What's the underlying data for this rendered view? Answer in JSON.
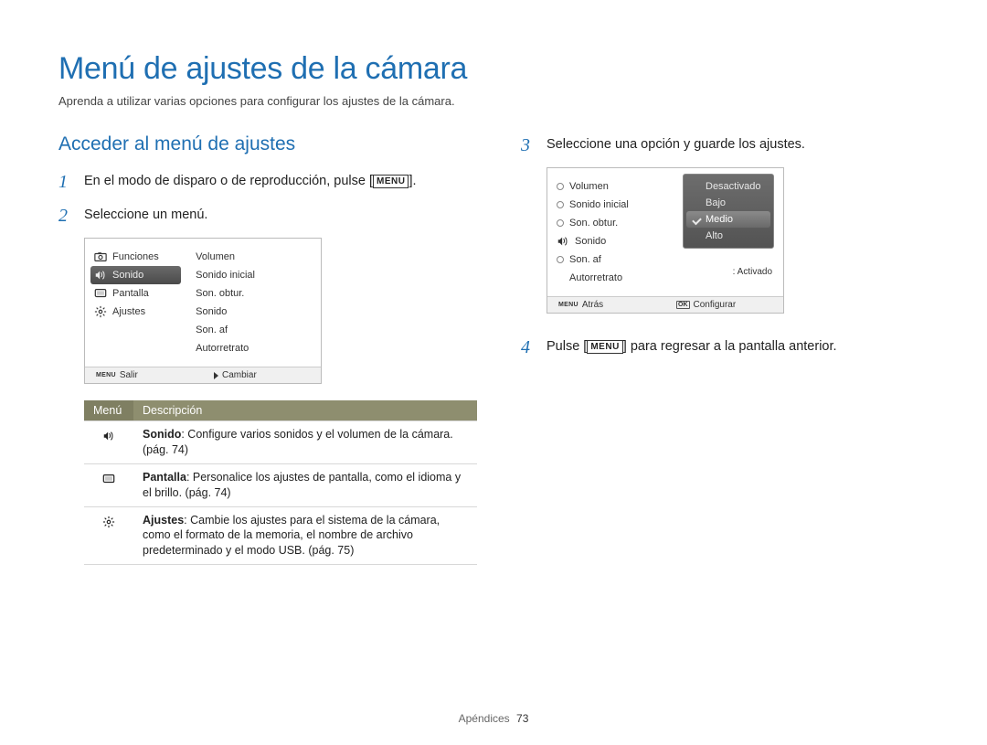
{
  "title": "Menú de ajustes de la cámara",
  "subtitle": "Aprenda a utilizar varias opciones para configurar los ajustes de la cámara.",
  "section_heading": "Acceder al menú de ajustes",
  "menu_button": "MENU",
  "steps": {
    "s1_pre": "En el modo de disparo o de reproducción, pulse [",
    "s1_post": "].",
    "s2": "Seleccione un menú.",
    "s3": "Seleccione una opción y guarde los ajustes.",
    "s4_pre": "Pulse [",
    "s4_post": "] para regresar a la pantalla anterior."
  },
  "lcd1": {
    "left": {
      "items": [
        {
          "icon": "camera-icon",
          "label": "Funciones",
          "selected": false
        },
        {
          "icon": "sound-icon",
          "label": "Sonido",
          "selected": true
        },
        {
          "icon": "display-icon",
          "label": "Pantalla",
          "selected": false
        },
        {
          "icon": "gear-icon",
          "label": "Ajustes",
          "selected": false
        }
      ]
    },
    "right": [
      "Volumen",
      "Sonido inicial",
      "Son. obtur.",
      "Sonido",
      "Son. af",
      "Autorretrato"
    ],
    "foot": {
      "left_icon": "MENU",
      "left": "Salir",
      "right_icon": "▶",
      "right": "Cambiar"
    }
  },
  "lcd2": {
    "rows": [
      {
        "bullet": "dot",
        "label": "Volumen",
        "value": ""
      },
      {
        "bullet": "dot",
        "label": "Sonido inicial",
        "value": ""
      },
      {
        "bullet": "dot",
        "label": "Son. obtur.",
        "value": ""
      },
      {
        "bullet": "sound",
        "label": "Sonido",
        "value": ""
      },
      {
        "bullet": "dot",
        "label": "Son. af",
        "value": ""
      },
      {
        "bullet": "none",
        "label": "Autorretrato",
        "value": ": Activado"
      }
    ],
    "popup": {
      "options": [
        "Desactivado",
        "Bajo",
        "Medio",
        "Alto"
      ],
      "selected_index": 2
    },
    "foot": {
      "left_icon": "MENU",
      "left": "Atrás",
      "right_icon": "OK",
      "right": "Configurar"
    }
  },
  "desc_table": {
    "head": {
      "col1": "Menú",
      "col2": "Descripción"
    },
    "rows": [
      {
        "icon": "sound-icon",
        "bold": "Sonido",
        "text": ": Configure varios sonidos y el volumen de la cámara. (pág. 74)"
      },
      {
        "icon": "display-icon",
        "bold": "Pantalla",
        "text": ": Personalice los ajustes de pantalla, como el idioma y el brillo. (pág. 74)"
      },
      {
        "icon": "gear-icon",
        "bold": "Ajustes",
        "text": ": Cambie los ajustes para el sistema de la cámara, como el formato de la memoria, el nombre de archivo predeterminado y el modo USB. (pág. 75)"
      }
    ]
  },
  "footer": {
    "section": "Apéndices",
    "page": "73"
  }
}
